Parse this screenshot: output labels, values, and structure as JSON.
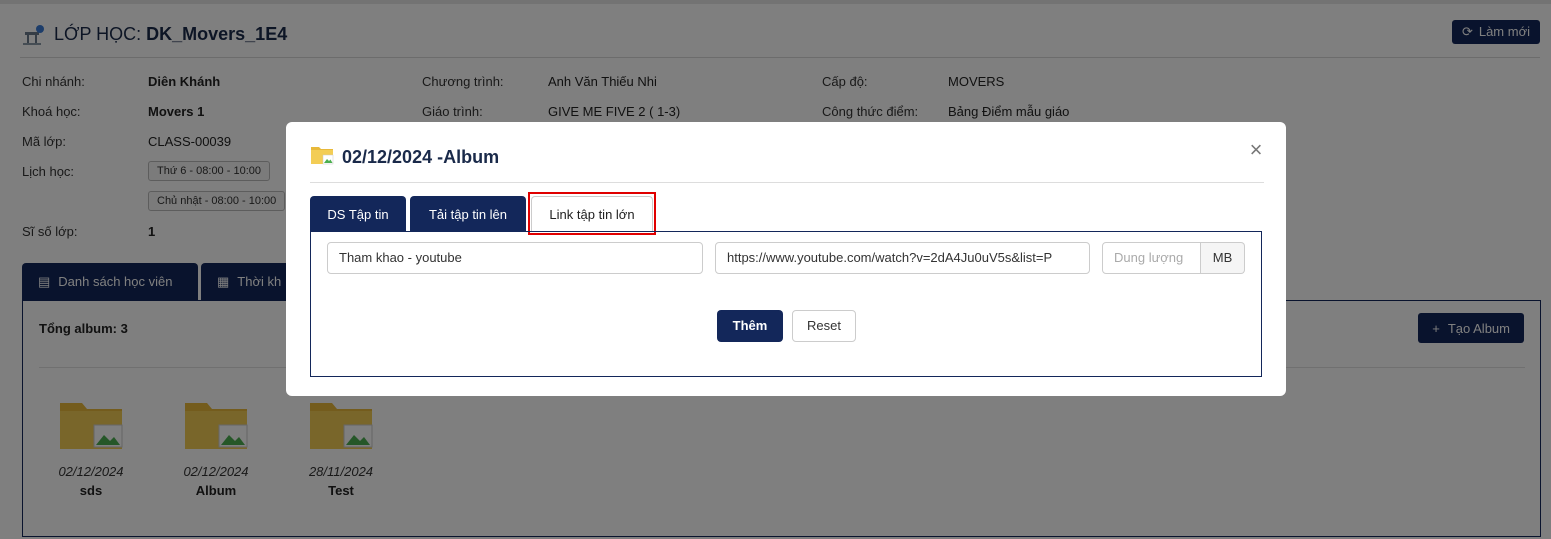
{
  "header": {
    "title_prefix": "LỚP HỌC: ",
    "class_code": "DK_Movers_1E4",
    "refresh_label": "Làm mới"
  },
  "class_info": {
    "branch_label": "Chi nhánh:",
    "branch_value": "Diên Khánh",
    "course_label": "Khoá học:",
    "course_value": "Movers 1",
    "class_id_label": "Mã lớp:",
    "class_id_value": "CLASS-00039",
    "schedule_label": "Lịch học:",
    "schedule": [
      "Thứ 6 - 08:00 - 10:00",
      "Chủ nhật - 08:00 - 10:00"
    ],
    "size_label": "Sĩ số lớp:",
    "size_value": "1",
    "program_label": "Chương trình:",
    "program_value": "Anh Văn Thiếu Nhi",
    "textbook_label": "Giáo trình:",
    "textbook_value": "GIVE ME FIVE 2 ( 1-3)",
    "level_label": "Cấp độ:",
    "level_value": "MOVERS",
    "formula_label": "Công thức điểm:",
    "formula_value": "Bảng Điểm mẫu giáo"
  },
  "main_tabs": [
    {
      "label": "Danh sách học viên"
    },
    {
      "label": "Thời kh"
    }
  ],
  "album_panel": {
    "total_label": "Tổng album: 3",
    "create_label": "Tạo Album",
    "albums": [
      {
        "date": "02/12/2024",
        "name": "sds"
      },
      {
        "date": "02/12/2024",
        "name": "Album"
      },
      {
        "date": "28/11/2024",
        "name": "Test"
      }
    ]
  },
  "modal": {
    "title": "02/12/2024 -Album",
    "tabs": [
      "DS Tập tin",
      "Tải tập tin lên",
      "Link tập tin lớn"
    ],
    "active_tab": "Link tập tin lớn",
    "name_value": "Tham khao - youtube",
    "url_value": "https://www.youtube.com/watch?v=2dA4Ju0uV5s&list=P",
    "size_placeholder": "Dung lượng",
    "size_unit": "MB",
    "add_label": "Thêm",
    "reset_label": "Reset"
  },
  "colors": {
    "primary": "#13275a",
    "highlight": "#e00000"
  }
}
